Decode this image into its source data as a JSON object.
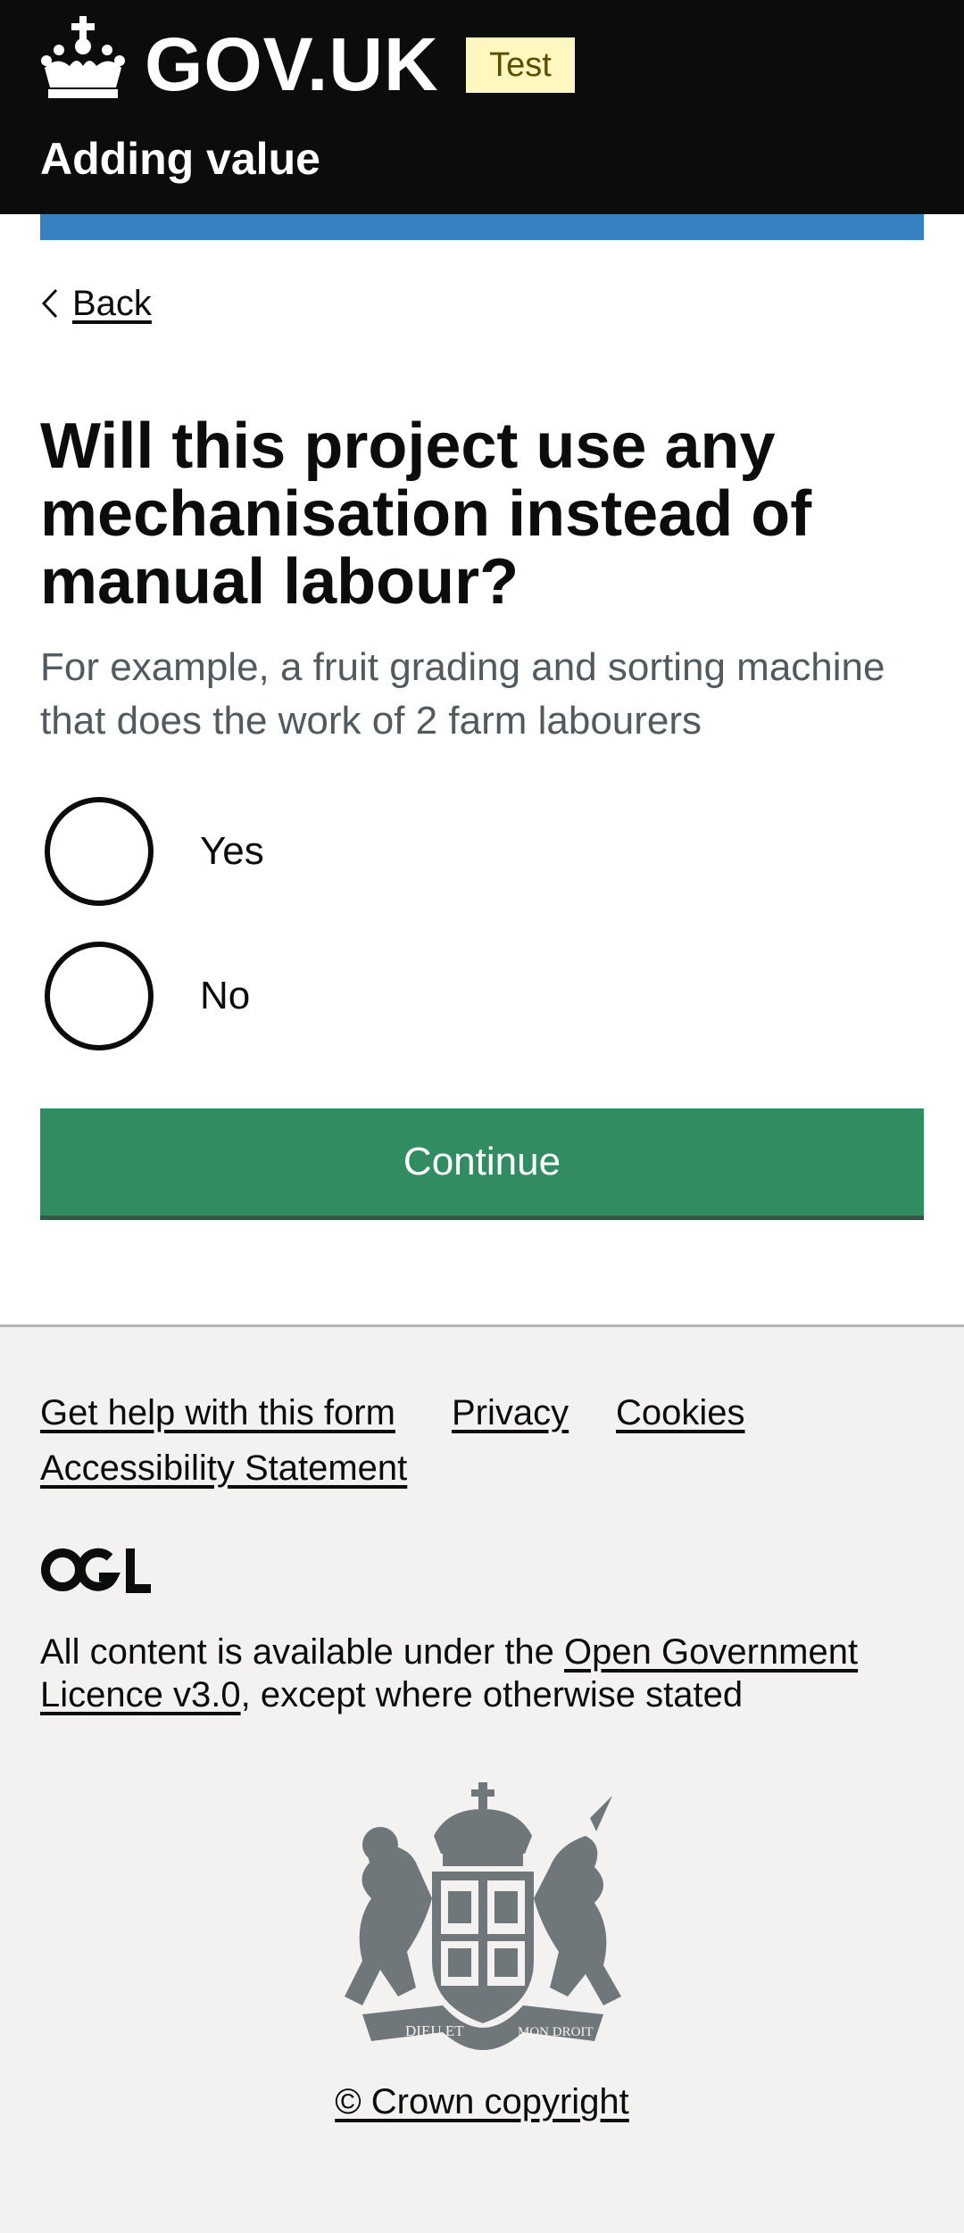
{
  "header": {
    "brand": "GOV.UK",
    "tag": "Test",
    "service_name": "Adding value",
    "crown_icon": "crown-icon"
  },
  "nav": {
    "back_label": "Back",
    "back_icon": "chevron-left-icon"
  },
  "form": {
    "question": "Will this project use any mechanisation instead of manual labour?",
    "hint": "For example, a fruit grading and sorting machine that does the work of 2 farm labourers",
    "options": [
      {
        "label": "Yes",
        "selected": false
      },
      {
        "label": "No",
        "selected": false
      }
    ],
    "continue_label": "Continue"
  },
  "footer": {
    "links": [
      "Get help with this form",
      "Privacy",
      "Cookies",
      "Accessibility Statement"
    ],
    "ogl_label": "OGL",
    "licence_prefix": "All content is available under the ",
    "licence_link": "Open Government Licence v3.0",
    "licence_suffix": ", except where otherwise stated",
    "crest_icon": "royal-coat-of-arms-icon",
    "crest_mottos": [
      "DIEU ET",
      "MON DROIT"
    ],
    "copyright": "© Crown copyright"
  },
  "colors": {
    "header_bg": "#0b0c0c",
    "accent_blue": "#1d70b8",
    "button_green": "#00703c",
    "hint_grey": "#505a5f",
    "footer_bg": "#f3f2f1",
    "tag_bg": "#fff7bf"
  }
}
